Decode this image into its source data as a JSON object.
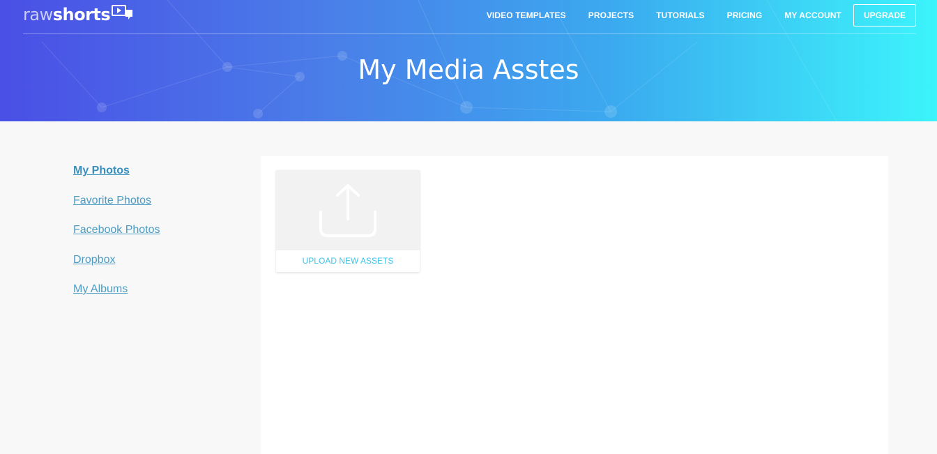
{
  "brand": {
    "raw": "raw",
    "shorts": "shorts"
  },
  "nav": {
    "items": [
      "VIDEO TEMPLATES",
      "PROJECTS",
      "TUTORIALS",
      "PRICING",
      "MY ACCOUNT"
    ],
    "upgrade": "UPGRADE"
  },
  "header": {
    "title": "My Media Asstes"
  },
  "sidebar": {
    "items": [
      {
        "label": "My Photos",
        "active": true
      },
      {
        "label": "Favorite Photos",
        "active": false
      },
      {
        "label": "Facebook Photos",
        "active": false
      },
      {
        "label": "Dropbox",
        "active": false
      },
      {
        "label": "My Albums",
        "active": false
      }
    ]
  },
  "upload": {
    "label": "UPLOAD NEW ASSETS",
    "icon": "upload-icon"
  },
  "colors": {
    "accent": "#3fc3e8",
    "link": "#4a9cc4",
    "gradient_start": "#4a4fe6",
    "gradient_end": "#3cf4fb"
  }
}
